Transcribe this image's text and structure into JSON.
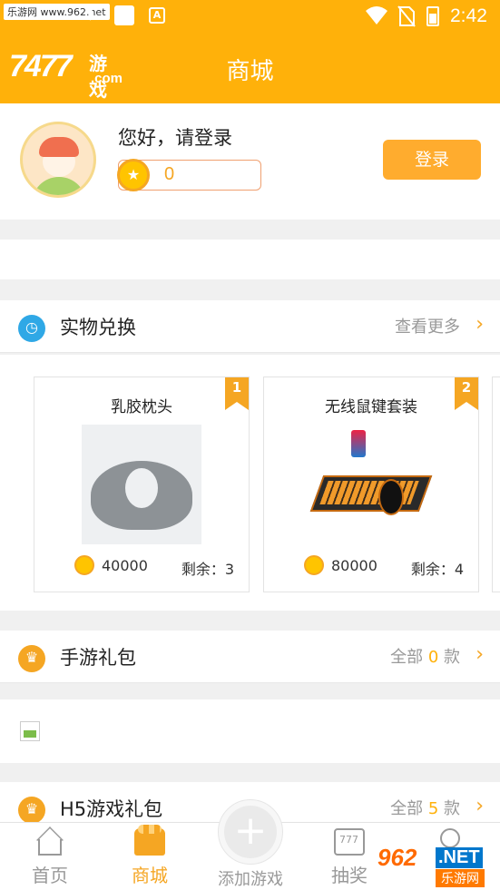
{
  "status_bar": {
    "watermark": "乐游网 www.962.net",
    "time": "2:42"
  },
  "header": {
    "logo_number": "7477",
    "logo_text": "游戏",
    "logo_domain": ".com",
    "title": "商城"
  },
  "user": {
    "greeting": "您好，请登录",
    "coins": "0",
    "login_label": "登录"
  },
  "physical_exchange": {
    "title": "实物兑换",
    "more_label": "查看更多",
    "products": [
      {
        "rank": "1",
        "name": "乳胶枕头",
        "price": "40000",
        "stock": "剩余：3"
      },
      {
        "rank": "2",
        "name": "无线鼠键套装",
        "price": "80000",
        "stock": "剩余：4"
      }
    ]
  },
  "mobile_gifts": {
    "title": "手游礼包",
    "all_prefix": "全部",
    "count": "0",
    "all_suffix": "款"
  },
  "h5_gifts": {
    "title": "H5游戏礼包",
    "all_prefix": "全部",
    "count": "5",
    "all_suffix": "款"
  },
  "tab_bar": {
    "tabs": [
      {
        "label": "首页"
      },
      {
        "label": "商城"
      },
      {
        "label": "添加游戏"
      },
      {
        "label": "抽奖"
      },
      {
        "label": ""
      }
    ]
  },
  "overlay_logo": {
    "badge": "962",
    "net": ".NET",
    "cn": "乐游网"
  },
  "colors": {
    "brand": "#ffb10a",
    "accent": "#f5a623"
  }
}
